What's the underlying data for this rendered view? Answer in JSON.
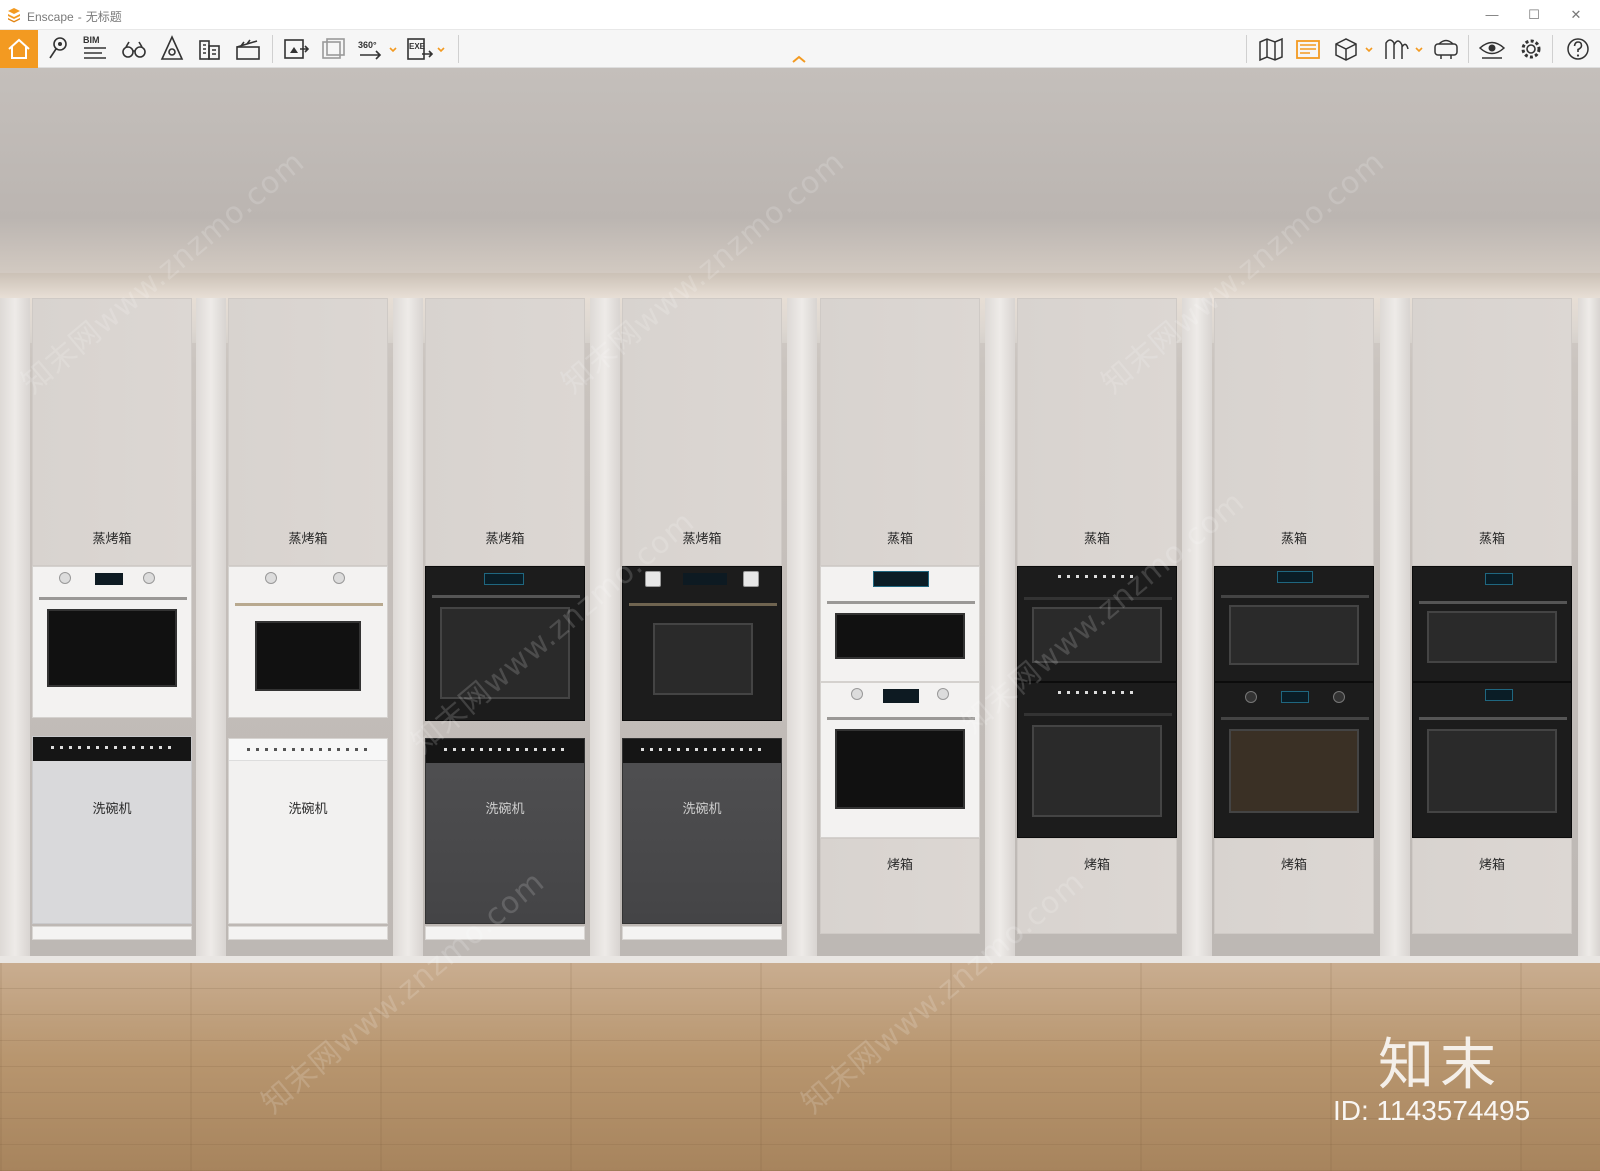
{
  "window": {
    "app_name": "Enscape",
    "separator": "-",
    "document_title": "无标题",
    "controls": [
      "—",
      "☐",
      "✕"
    ]
  },
  "toolbar": {
    "left_icons": [
      "home-icon",
      "location-pin-icon",
      "bim-icon",
      "binoculars-icon",
      "light-view-icon",
      "buildings-icon",
      "video-clapper-icon",
      "screenshot-export-icon",
      "batch-render-icon",
      "panorama-360-icon",
      "exe-export-icon"
    ],
    "bim_label": "BIM",
    "pano_label": "360°",
    "exe_label": "EXE",
    "right_icons": [
      "map-icon",
      "asset-library-icon",
      "cube-view-icon",
      "material-icon",
      "vr-headset-icon",
      "visibility-eye-icon",
      "settings-gear-icon",
      "help-icon"
    ],
    "accent_color": "#f39a21"
  },
  "scene": {
    "columns": [
      {
        "top_label": "蒸烤箱",
        "bottom_label": "洗碗机",
        "oven": "white",
        "lower": "dishwasher-grey"
      },
      {
        "top_label": "蒸烤箱",
        "bottom_label": "洗碗机",
        "oven": "white",
        "lower": "dishwasher-white"
      },
      {
        "top_label": "蒸烤箱",
        "bottom_label": "洗碗机",
        "oven": "black",
        "lower": "dishwasher-dark"
      },
      {
        "top_label": "蒸烤箱",
        "bottom_label": "洗碗机",
        "oven": "black",
        "lower": "dishwasher-dark"
      },
      {
        "top_label": "蒸箱",
        "bottom_label": "烤箱",
        "oven": "white-double"
      },
      {
        "top_label": "蒸箱",
        "bottom_label": "烤箱",
        "oven": "black-double"
      },
      {
        "top_label": "蒸箱",
        "bottom_label": "烤箱",
        "oven": "black-double"
      },
      {
        "top_label": "蒸箱",
        "bottom_label": "烤箱",
        "oven": "black-double"
      }
    ]
  },
  "watermark": {
    "repeat_text": "知末网www.znzmo.com",
    "brand": "知末",
    "id_label": "ID: 1143574495"
  }
}
